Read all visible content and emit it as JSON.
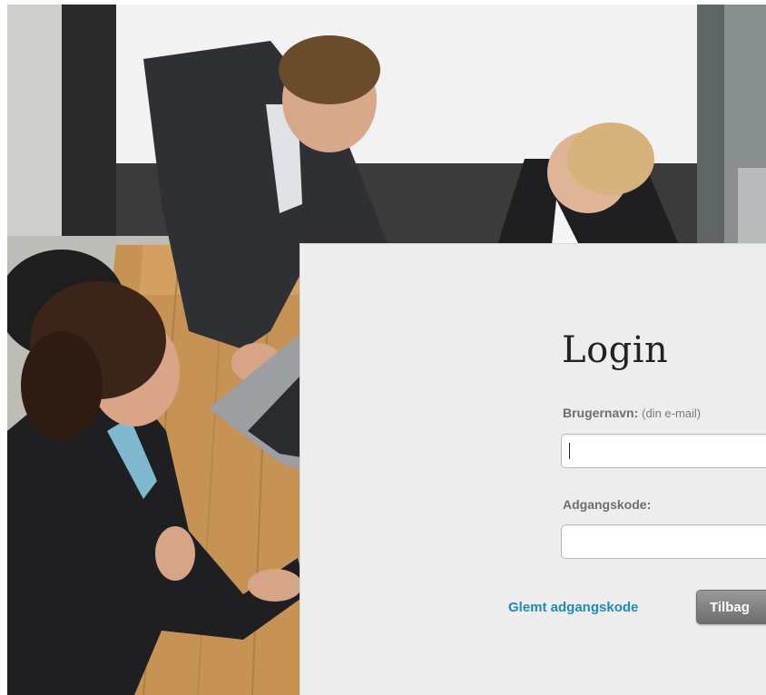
{
  "login": {
    "title": "Login",
    "username_label": "Brugernavn:",
    "username_hint": "(din e-mail)",
    "username_value": "",
    "password_label": "Adgangskode:",
    "password_value": "",
    "forgot_link": "Glemt adgangskode",
    "back_button": "Tilbag"
  },
  "colors": {
    "panel_bg": "#eeedee",
    "link": "#1c8bbd",
    "button": "#808080",
    "label": "#6e6e6e"
  },
  "icons": {
    "background_photo": "business-people-meeting-photo"
  }
}
